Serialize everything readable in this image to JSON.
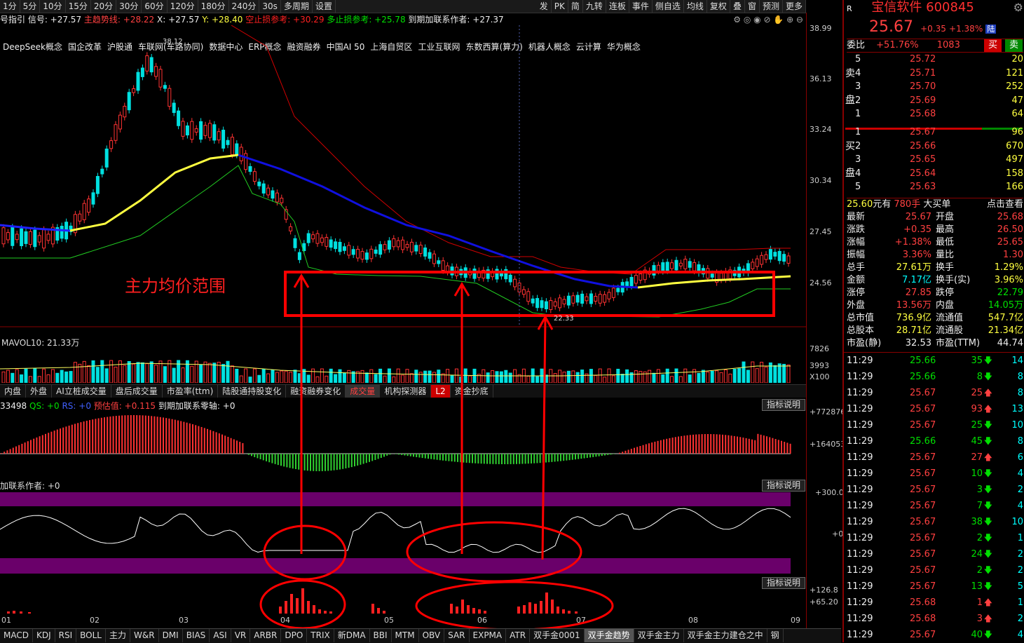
{
  "toolbar": {
    "periods": [
      "1分",
      "5分",
      "10分",
      "15分",
      "20分",
      "30分",
      "60分",
      "120分",
      "180分",
      "240分",
      "30s",
      "多周期",
      "设置"
    ],
    "right_tools": [
      "发",
      "PK",
      "简",
      "九转",
      "连板",
      "事件",
      "侧自选",
      "均线",
      "复权",
      "叠",
      "窗",
      "预测",
      "更多"
    ]
  },
  "signal_line": {
    "prefix": "号指引 信号: +27.57",
    "main_trend": "主趋势线: +28.22",
    "x": "X: +27.57",
    "y": "Y: +28.40",
    "short_stop": "空止损参考: +30.29",
    "long_stop": "多止损参考: +25.78",
    "author": "到期加联系作者: +27.37"
  },
  "concepts": [
    "DeepSeek概念",
    "国企改革",
    "沪股通",
    "车联网(车路协同)",
    "数据中心",
    "ERP概念",
    "融资融券",
    "中国AI 50",
    "上海自贸区",
    "工业互联网",
    "东数西算(算力)",
    "机器人概念",
    "云计算",
    "华为概念"
  ],
  "annotation": {
    "label": "主力均价范围"
  },
  "price_axis": [
    "38.99",
    "36.13",
    "33.24",
    "30.34",
    "27.45",
    "24.56"
  ],
  "price_marks": {
    "high": "38.12",
    "low": "22.33"
  },
  "volume": {
    "label": "MAVOL10: 21.33万",
    "axis": [
      "7826",
      "3993",
      "X100"
    ]
  },
  "mid_tabs": [
    "内盘",
    "外盘",
    "AI立桩成交量",
    "盘后成交量",
    "市盈率(ttm)",
    "陆股通持股变化",
    "融资融券变化",
    "成交量",
    "机构探测器",
    "L2",
    "资金抄底"
  ],
  "macd_panel": {
    "label": "33498",
    "qs": "QS: +0",
    "rs": "RS: +0",
    "forecast": "预估值: +0.115",
    "note": "到期加联系零轴: +0",
    "axis": [
      "+772876",
      "+164053"
    ],
    "button": "指标说明"
  },
  "osc_panel": {
    "label": "加联系作者: +0",
    "axis": [
      "+300.0",
      "+0"
    ],
    "button": "指标说明"
  },
  "bar_panel": {
    "axis": [
      "+126.8",
      "+65.20"
    ],
    "button": "指标说明"
  },
  "months": [
    "01",
    "02",
    "03",
    "04",
    "05",
    "06",
    "07",
    "08",
    "09"
  ],
  "bottom_tabs": [
    "MACD",
    "KDJ",
    "RSI",
    "BOLL",
    "主力",
    "W&R",
    "DMI",
    "BIAS",
    "ASI",
    "VR",
    "ARBR",
    "DPO",
    "TRIX",
    "新DMA",
    "BBI",
    "MTM",
    "OBV",
    "SAR",
    "EXPMA",
    "ATR",
    "双手金0001",
    "双手金趋势",
    "双手金主力",
    "双手金主力建仓之中",
    "钢"
  ],
  "quote": {
    "name": "宝信软件 600845",
    "price": "25.67",
    "change": "+0.35",
    "pct": "+1.38%",
    "weibi_label": "委比",
    "weibi": "+51.76%",
    "weicha": "1083",
    "sell_btn": "买",
    "buy_btn": "卖",
    "sell_label": [
      "卖",
      "盘"
    ],
    "buy_label": [
      "买",
      "盘"
    ],
    "asks": [
      {
        "lvl": "5",
        "price": "25.72",
        "vol": "20"
      },
      {
        "lvl": "4",
        "price": "25.71",
        "vol": "121"
      },
      {
        "lvl": "3",
        "price": "25.70",
        "vol": "252"
      },
      {
        "lvl": "2",
        "price": "25.69",
        "vol": "47"
      },
      {
        "lvl": "1",
        "price": "25.68",
        "vol": "64"
      }
    ],
    "bids": [
      {
        "lvl": "1",
        "price": "25.67",
        "vol": "96"
      },
      {
        "lvl": "2",
        "price": "25.66",
        "vol": "670"
      },
      {
        "lvl": "3",
        "price": "25.65",
        "vol": "497"
      },
      {
        "lvl": "4",
        "price": "25.64",
        "vol": "158"
      },
      {
        "lvl": "5",
        "price": "25.63",
        "vol": "166"
      }
    ],
    "big_order": {
      "price": "25.60",
      "unit": "元有",
      "vol": "780手",
      "label": "大买单",
      "link": "点击查看"
    },
    "stats": [
      [
        "最新",
        "25.67",
        "开盘",
        "25.68"
      ],
      [
        "涨跌",
        "+0.35",
        "最高",
        "26.50"
      ],
      [
        "涨幅",
        "+1.38%",
        "最低",
        "25.65"
      ],
      [
        "振幅",
        "3.36%",
        "量比",
        "1.30"
      ],
      [
        "总手",
        "27.61万",
        "换手",
        "1.29%"
      ],
      [
        "金额",
        "7.17亿",
        "换手(实)",
        "3.96%"
      ],
      [
        "涨停",
        "27.85",
        "跌停",
        "22.79"
      ],
      [
        "外盘",
        "13.56万",
        "内盘",
        "14.05万"
      ],
      [
        "总市值",
        "736.9亿",
        "流通值",
        "547.7亿"
      ],
      [
        "总股本",
        "28.71亿",
        "流通股",
        "21.34亿"
      ],
      [
        "市盈(静)",
        "32.53",
        "市盈(TTM)",
        "44.74"
      ]
    ],
    "ticks": [
      [
        "11:29",
        "25.66",
        "35",
        "down",
        "14"
      ],
      [
        "11:29",
        "25.66",
        "8",
        "down",
        "8"
      ],
      [
        "11:29",
        "25.67",
        "25",
        "up",
        "8"
      ],
      [
        "11:29",
        "25.67",
        "93",
        "up",
        "13"
      ],
      [
        "11:29",
        "25.67",
        "25",
        "down",
        "10"
      ],
      [
        "11:29",
        "25.66",
        "45",
        "down",
        "8"
      ],
      [
        "11:29",
        "25.67",
        "27",
        "up",
        "6"
      ],
      [
        "11:29",
        "25.67",
        "10",
        "down",
        "4"
      ],
      [
        "11:29",
        "25.67",
        "3",
        "down",
        "2"
      ],
      [
        "11:29",
        "25.67",
        "7",
        "down",
        "4"
      ],
      [
        "11:29",
        "25.67",
        "38",
        "down",
        "10"
      ],
      [
        "11:29",
        "25.67",
        "2",
        "down",
        "1"
      ],
      [
        "11:29",
        "25.67",
        "24",
        "down",
        "2"
      ],
      [
        "11:29",
        "25.67",
        "2",
        "down",
        "2"
      ],
      [
        "11:29",
        "25.67",
        "13",
        "down",
        "5"
      ],
      [
        "11:29",
        "25.68",
        "1",
        "up",
        "1"
      ],
      [
        "11:29",
        "25.68",
        "3",
        "up",
        "2"
      ],
      [
        "11:29",
        "25.67",
        "40",
        "down",
        "4"
      ]
    ]
  },
  "colors": {
    "up": "#ff3232",
    "down": "#00e0e0",
    "yellow_ma": "#ffff40",
    "blue_ma": "#2020ff",
    "purple": "#6a006a"
  }
}
